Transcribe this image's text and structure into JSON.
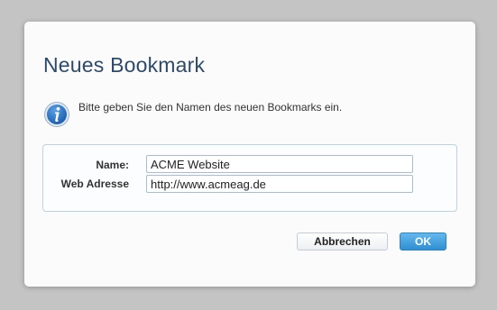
{
  "dialog": {
    "title": "Neues Bookmark",
    "info_icon": "info-icon",
    "info_text": "Bitte geben Sie den Namen des neuen Bookmarks ein."
  },
  "form": {
    "name_label": "Name:",
    "name_value": "ACME Website",
    "web_label": "Web Adresse",
    "web_value": "http://www.acmeag.de"
  },
  "buttons": {
    "cancel_label": "Abbrechen",
    "ok_label": "OK"
  },
  "colors": {
    "title": "#2d4a6b",
    "ok_button": "#3a9ee0",
    "background": "#c4c4c4"
  }
}
